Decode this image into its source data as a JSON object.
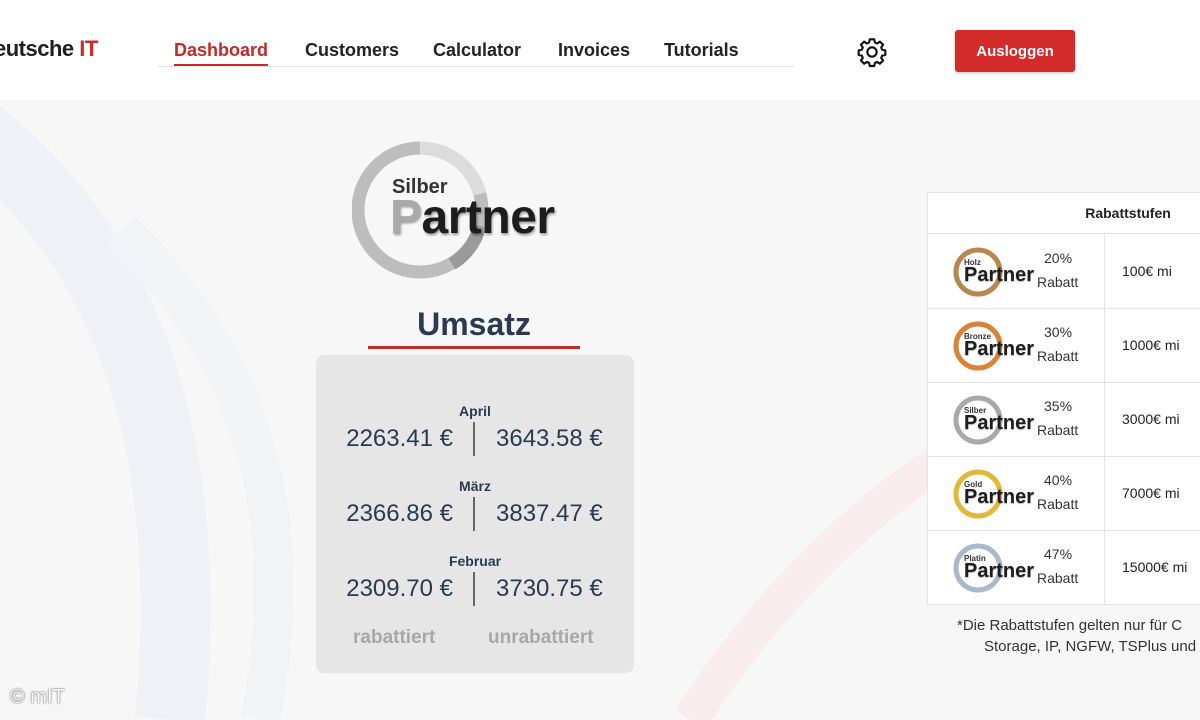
{
  "brand": {
    "name_prefix": "eutsche ",
    "name_suffix": "IT"
  },
  "nav": {
    "items": [
      {
        "label": "Dashboard",
        "active": true
      },
      {
        "label": "Customers",
        "active": false
      },
      {
        "label": "Calculator",
        "active": false
      },
      {
        "label": "Invoices",
        "active": false
      },
      {
        "label": "Tutorials",
        "active": false
      }
    ]
  },
  "header": {
    "logout_label": "Ausloggen"
  },
  "partner_badge": {
    "level": "Silber",
    "word_first": "P",
    "word_rest": "artner"
  },
  "umsatz": {
    "title": "Umsatz",
    "months": [
      {
        "name": "April",
        "discounted": "2263.41 €",
        "undiscounted": "3643.58 €"
      },
      {
        "name": "März",
        "discounted": "2366.86 €",
        "undiscounted": "3837.47 €"
      },
      {
        "name": "Februar",
        "discounted": "2309.70 €",
        "undiscounted": "3730.75 €"
      }
    ],
    "label_discounted": "rabattiert",
    "label_undiscounted": "unrabattiert"
  },
  "rabattstufen": {
    "title": "Rabattstufen",
    "tiers": [
      {
        "level": "Holz",
        "word_first": "P",
        "word_rest": "artner",
        "percent": "20%",
        "rabatt_label": "Rabatt",
        "minimum": "100€ mi",
        "color": "#b8874f"
      },
      {
        "level": "Bronze",
        "word_first": "P",
        "word_rest": "artner",
        "percent": "30%",
        "rabatt_label": "Rabatt",
        "minimum": "1000€ mi",
        "color": "#d9823a"
      },
      {
        "level": "Silber",
        "word_first": "P",
        "word_rest": "artner",
        "percent": "35%",
        "rabatt_label": "Rabatt",
        "minimum": "3000€ mi",
        "color": "#a9a9a9"
      },
      {
        "level": "Gold",
        "word_first": "P",
        "word_rest": "artner",
        "percent": "40%",
        "rabatt_label": "Rabatt",
        "minimum": "7000€ mi",
        "color": "#e2b83a"
      },
      {
        "level": "Platin",
        "word_first": "P",
        "word_rest": "artner",
        "percent": "47%",
        "rabatt_label": "Rabatt",
        "minimum": "15000€ mi",
        "color": "#a9b8cc"
      }
    ],
    "note_line1": "*Die Rabattstufen gelten nur für C",
    "note_line2": "Storage, IP, NGFW, TSPlus und"
  },
  "watermark": "© mIT",
  "colors": {
    "accent": "#c62828",
    "navy": "#2a3a52"
  }
}
